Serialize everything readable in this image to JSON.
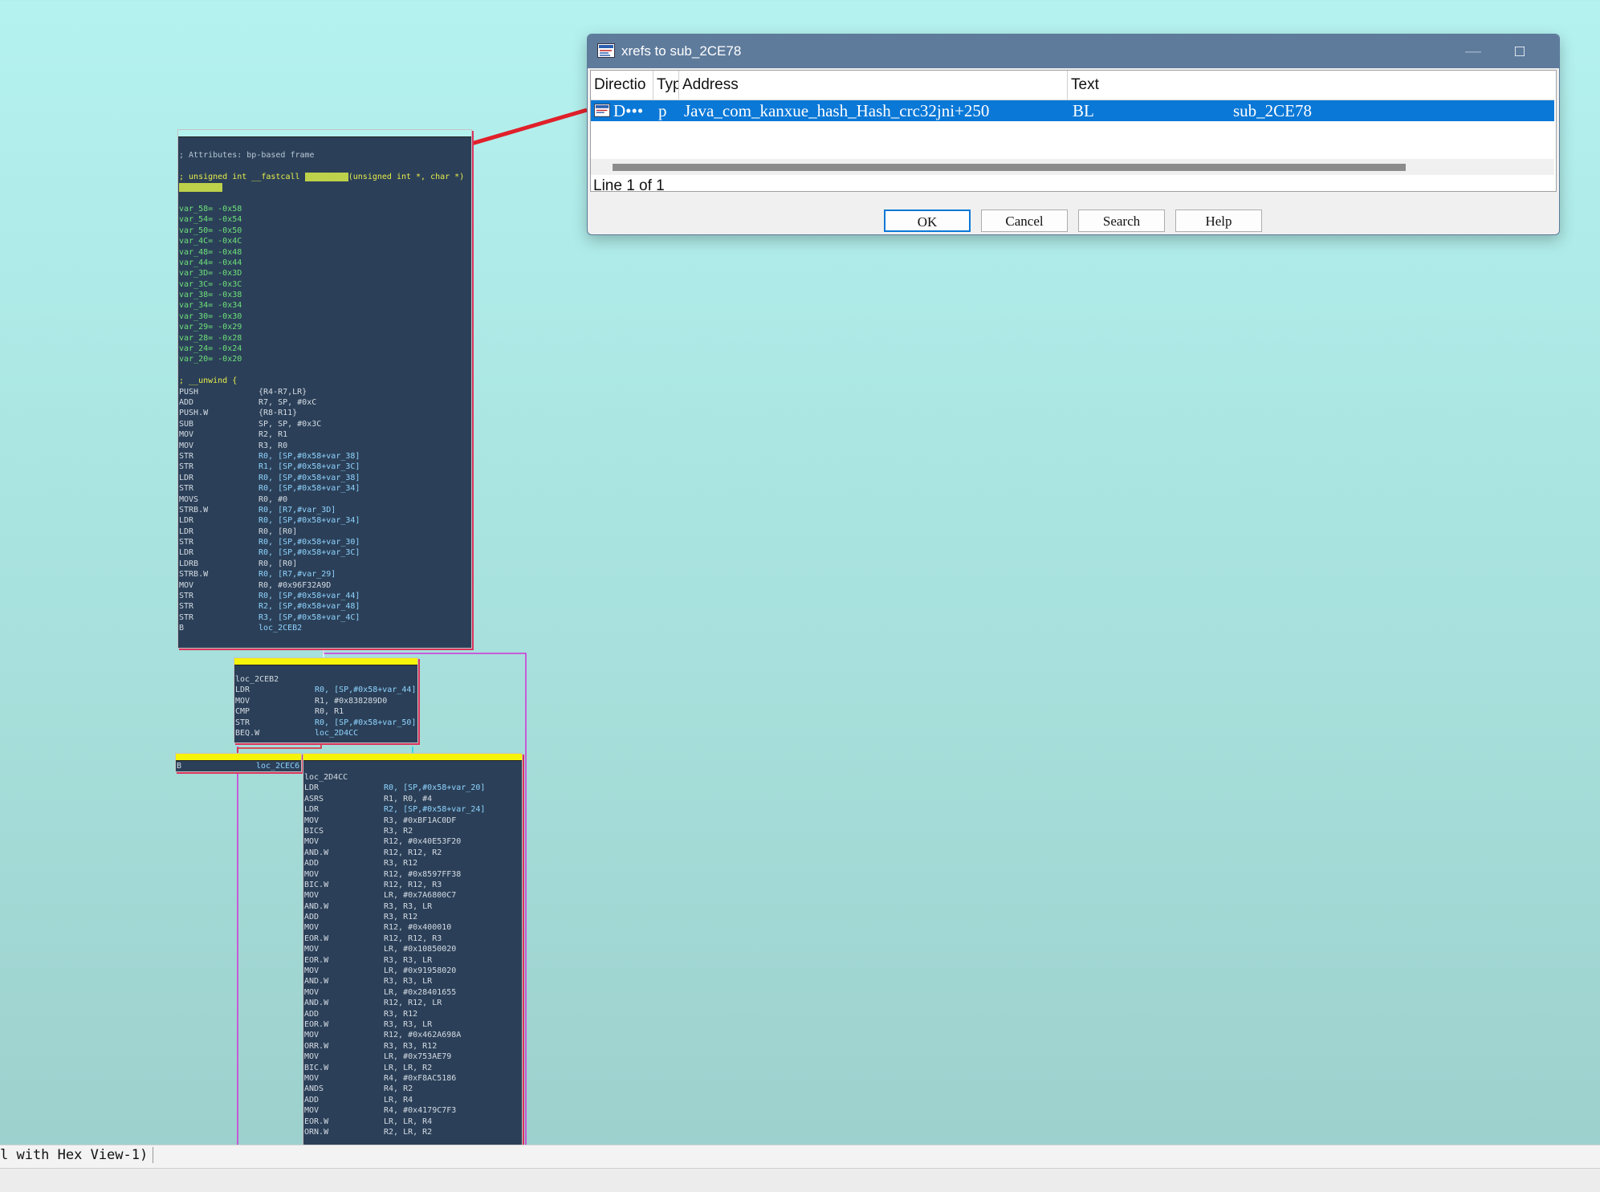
{
  "dialog": {
    "title": "xrefs to sub_2CE78",
    "columns": [
      "Directio",
      "Typ",
      "Address",
      "Text"
    ],
    "row": {
      "direction": "D•••",
      "type": "p",
      "address": "Java_com_kanxue_hash_Hash_crc32jni+250",
      "text_mnemonic": "BL",
      "text_operand": "sub_2CE78"
    },
    "status": "Line 1 of 1",
    "buttons": {
      "ok": "OK",
      "cancel": "Cancel",
      "search": "Search",
      "help": "Help"
    },
    "minimize_glyph": "—",
    "maximize_glyph": "□",
    "close_glyph": "✕"
  },
  "block1": {
    "attributes": "; Attributes: bp-based frame",
    "proto_prefix": "; unsigned int __fastcall ",
    "proto_suffix": "(unsigned int *, char *)",
    "vars": [
      "var_58= -0x58",
      "var_54= -0x54",
      "var_50= -0x50",
      "var_4C= -0x4C",
      "var_48= -0x48",
      "var_44= -0x44",
      "var_3D= -0x3D",
      "var_3C= -0x3C",
      "var_38= -0x38",
      "var_34= -0x34",
      "var_30= -0x30",
      "var_29= -0x29",
      "var_28= -0x28",
      "var_24= -0x24",
      "var_20= -0x20"
    ],
    "unwind": "; __unwind {",
    "instructions": [
      {
        "m": "PUSH",
        "o": "{R4-R7,LR}"
      },
      {
        "m": "ADD",
        "o": "R7, SP, #0xC"
      },
      {
        "m": "PUSH.W",
        "o": "{R8-R11}"
      },
      {
        "m": "SUB",
        "o": "SP, SP, #0x3C"
      },
      {
        "m": "MOV",
        "o": "R2, R1"
      },
      {
        "m": "MOV",
        "o": "R3, R0"
      },
      {
        "m": "STR",
        "o": "R0, [SP,#0x58+var_38]"
      },
      {
        "m": "STR",
        "o": "R1, [SP,#0x58+var_3C]"
      },
      {
        "m": "LDR",
        "o": "R0, [SP,#0x58+var_38]"
      },
      {
        "m": "STR",
        "o": "R0, [SP,#0x58+var_34]"
      },
      {
        "m": "MOVS",
        "o": "R0, #0"
      },
      {
        "m": "STRB.W",
        "o": "R0, [R7,#var_3D]"
      },
      {
        "m": "LDR",
        "o": "R0, [SP,#0x58+var_34]"
      },
      {
        "m": "LDR",
        "o": "R0, [R0]"
      },
      {
        "m": "STR",
        "o": "R0, [SP,#0x58+var_30]"
      },
      {
        "m": "LDR",
        "o": "R0, [SP,#0x58+var_3C]"
      },
      {
        "m": "LDRB",
        "o": "R0, [R0]"
      },
      {
        "m": "STRB.W",
        "o": "R0, [R7,#var_29]"
      },
      {
        "m": "MOV",
        "o": "R0, #0x96F32A9D"
      },
      {
        "m": "STR",
        "o": "R0, [SP,#0x58+var_44]"
      },
      {
        "m": "STR",
        "o": "R2, [SP,#0x58+var_48]"
      },
      {
        "m": "STR",
        "o": "R3, [SP,#0x58+var_4C]"
      },
      {
        "m": "B",
        "o": "loc_2CEB2"
      }
    ]
  },
  "block2": {
    "label": "loc_2CEB2",
    "instructions": [
      {
        "m": "LDR",
        "o": "R0, [SP,#0x58+var_44]"
      },
      {
        "m": "MOV",
        "o": "R1, #0x838289D0"
      },
      {
        "m": "CMP",
        "o": "R0, R1"
      },
      {
        "m": "STR",
        "o": "R0, [SP,#0x58+var_50]"
      },
      {
        "m": "BEQ.W",
        "o": "loc_2D4CC"
      }
    ]
  },
  "block3": {
    "m": "B",
    "o": "loc_2CEC6"
  },
  "block4": {
    "label": "loc_2D4CC",
    "instructions": [
      {
        "m": "LDR",
        "o": "R0, [SP,#0x58+var_20]"
      },
      {
        "m": "ASRS",
        "o": "R1, R0, #4"
      },
      {
        "m": "LDR",
        "o": "R2, [SP,#0x58+var_24]"
      },
      {
        "m": "MOV",
        "o": "R3, #0xBF1AC0DF"
      },
      {
        "m": "BICS",
        "o": "R3, R2"
      },
      {
        "m": "MOV",
        "o": "R12, #0x40E53F20"
      },
      {
        "m": "AND.W",
        "o": "R12, R12, R2"
      },
      {
        "m": "ADD",
        "o": "R3, R12"
      },
      {
        "m": "MOV",
        "o": "R12, #0x8597FF38"
      },
      {
        "m": "BIC.W",
        "o": "R12, R12, R3"
      },
      {
        "m": "MOV",
        "o": "LR, #0x7A6800C7"
      },
      {
        "m": "AND.W",
        "o": "R3, R3, LR"
      },
      {
        "m": "ADD",
        "o": "R3, R12"
      },
      {
        "m": "MOV",
        "o": "R12, #0x400010"
      },
      {
        "m": "EOR.W",
        "o": "R12, R12, R3"
      },
      {
        "m": "MOV",
        "o": "LR, #0x10850020"
      },
      {
        "m": "EOR.W",
        "o": "R3, R3, LR"
      },
      {
        "m": "MOV",
        "o": "LR, #0x91958020"
      },
      {
        "m": "AND.W",
        "o": "R3, R3, LR"
      },
      {
        "m": "MOV",
        "o": "LR, #0x28401655"
      },
      {
        "m": "AND.W",
        "o": "R12, R12, LR"
      },
      {
        "m": "ADD",
        "o": "R3, R12"
      },
      {
        "m": "EOR.W",
        "o": "R3, R3, LR"
      },
      {
        "m": "MOV",
        "o": "R12, #0x462A698A"
      },
      {
        "m": "ORR.W",
        "o": "R3, R3, R12"
      },
      {
        "m": "MOV",
        "o": "LR, #0x753AE79"
      },
      {
        "m": "BIC.W",
        "o": "LR, LR, R2"
      },
      {
        "m": "MOV",
        "o": "R4, #0xF8AC5186"
      },
      {
        "m": "ANDS",
        "o": "R4, R2"
      },
      {
        "m": "ADD",
        "o": "LR, R4"
      },
      {
        "m": "MOV",
        "o": "R4, #0x4179C7F3"
      },
      {
        "m": "EOR.W",
        "o": "LR, LR, R4"
      },
      {
        "m": "ORN.W",
        "o": "R2, LR, R2"
      }
    ]
  },
  "bottom_text": "l with Hex View-1)",
  "colors": {
    "node_bg": "#2b4058",
    "selection": "#0a78d7",
    "dialog_title": "#5e7b9c",
    "arrow": "#e0202a",
    "edge_magenta": "#d230d8",
    "edge_red": "#e02030"
  }
}
